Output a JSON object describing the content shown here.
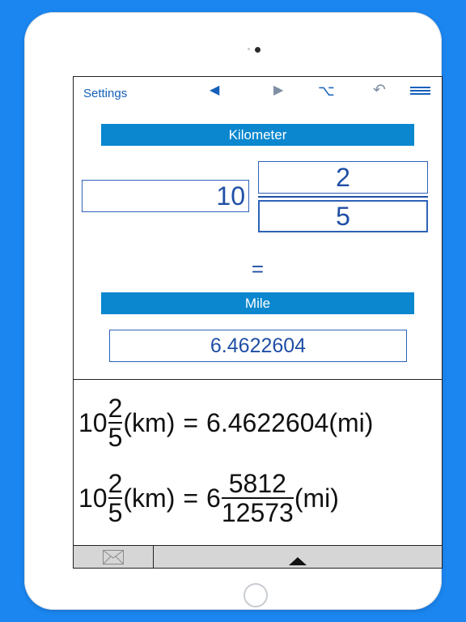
{
  "toolbar": {
    "settings_label": "Settings",
    "icons": [
      "back-arrow-icon",
      "forward-arrow-icon",
      "option-key-icon",
      "undo-icon",
      "menu-icon"
    ]
  },
  "converter": {
    "from_unit": "Kilometer",
    "whole": "10",
    "numerator": "2",
    "denominator": "5",
    "equals": "=",
    "to_unit": "Mile",
    "result": "6.4622604"
  },
  "formulas": {
    "decimal": {
      "whole": "10",
      "num": "2",
      "den": "5",
      "from_abbr": "(km)",
      "equals": "=",
      "value": "6.4622604",
      "to_abbr": "(mi)"
    },
    "fraction": {
      "whole": "10",
      "num": "2",
      "den": "5",
      "from_abbr": "(km)",
      "equals": "=",
      "result_whole": "6",
      "result_num": "5812",
      "result_den": "12573",
      "to_abbr": "(mi)"
    }
  },
  "colors": {
    "accent": "#0a87cf",
    "background": "#1b86f0",
    "text_blue": "#1f4fa5"
  }
}
